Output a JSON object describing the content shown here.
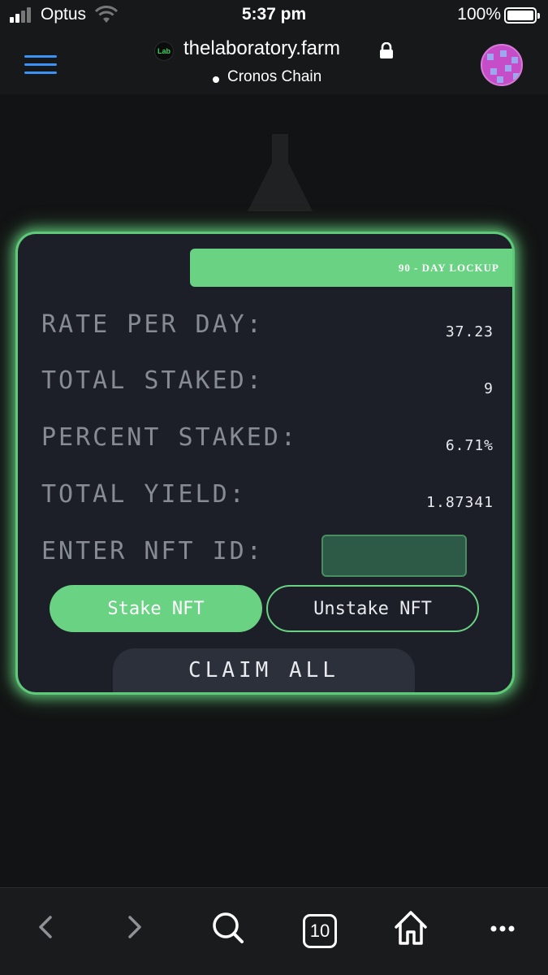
{
  "status_bar": {
    "carrier": "Optus",
    "time": "5:37 pm",
    "battery_percent": "100%",
    "icons": [
      "signal-icon",
      "wifi-icon",
      "battery-icon"
    ]
  },
  "browser": {
    "site_logo_text": "Lab",
    "url": "thelaboratory.farm",
    "network": "Cronos Chain",
    "accent_color": "#3b93f5",
    "avatar_color": "#c54ec8"
  },
  "staking": {
    "lockup_label": "90 - DAY LOCKUP",
    "rows": [
      {
        "label": "RATE PER DAY:",
        "value": "37.23"
      },
      {
        "label": "TOTAL STAKED:",
        "value": "9"
      },
      {
        "label": "PERCENT STAKED:",
        "value": "6.71%"
      },
      {
        "label": "TOTAL YIELD:",
        "value": "1.87341"
      }
    ],
    "nft_id_label": "ENTER NFT ID:",
    "nft_id_value": "",
    "stake_label": "Stake NFT",
    "unstake_label": "Unstake NFT",
    "claim_label": "CLAIM ALL",
    "accent_color": "#69d283"
  },
  "toolbar": {
    "tab_count": "10",
    "icons": [
      "back-icon",
      "forward-icon",
      "search-icon",
      "tabs-icon",
      "home-icon",
      "more-icon"
    ]
  }
}
